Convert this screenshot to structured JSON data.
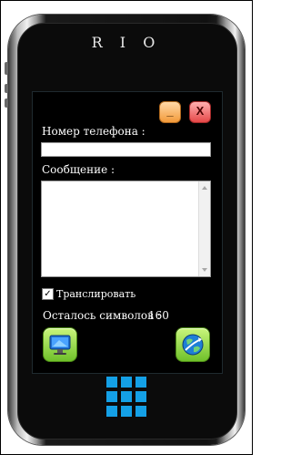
{
  "app": {
    "brand": "R I O"
  },
  "window_controls": {
    "minimize_label": "_",
    "close_label": "X"
  },
  "form": {
    "phone_label": "Номер телефона :",
    "phone_value": "",
    "message_label": "Сообщение :",
    "message_value": "",
    "translit_label": "Транслировать",
    "translit_checked": true,
    "translit_mark": "✓",
    "counter_label": "Осталось символов :",
    "counter_value": "160"
  },
  "buttons": {
    "monitor_icon": "monitor-icon",
    "globe_icon": "globe-icon"
  },
  "home": {
    "icon": "grid-icon"
  },
  "colors": {
    "accent_green": "#6fc12a",
    "home_blue": "#14a0e6",
    "close_red": "#e64848",
    "minimize_orange": "#f39a3a"
  }
}
